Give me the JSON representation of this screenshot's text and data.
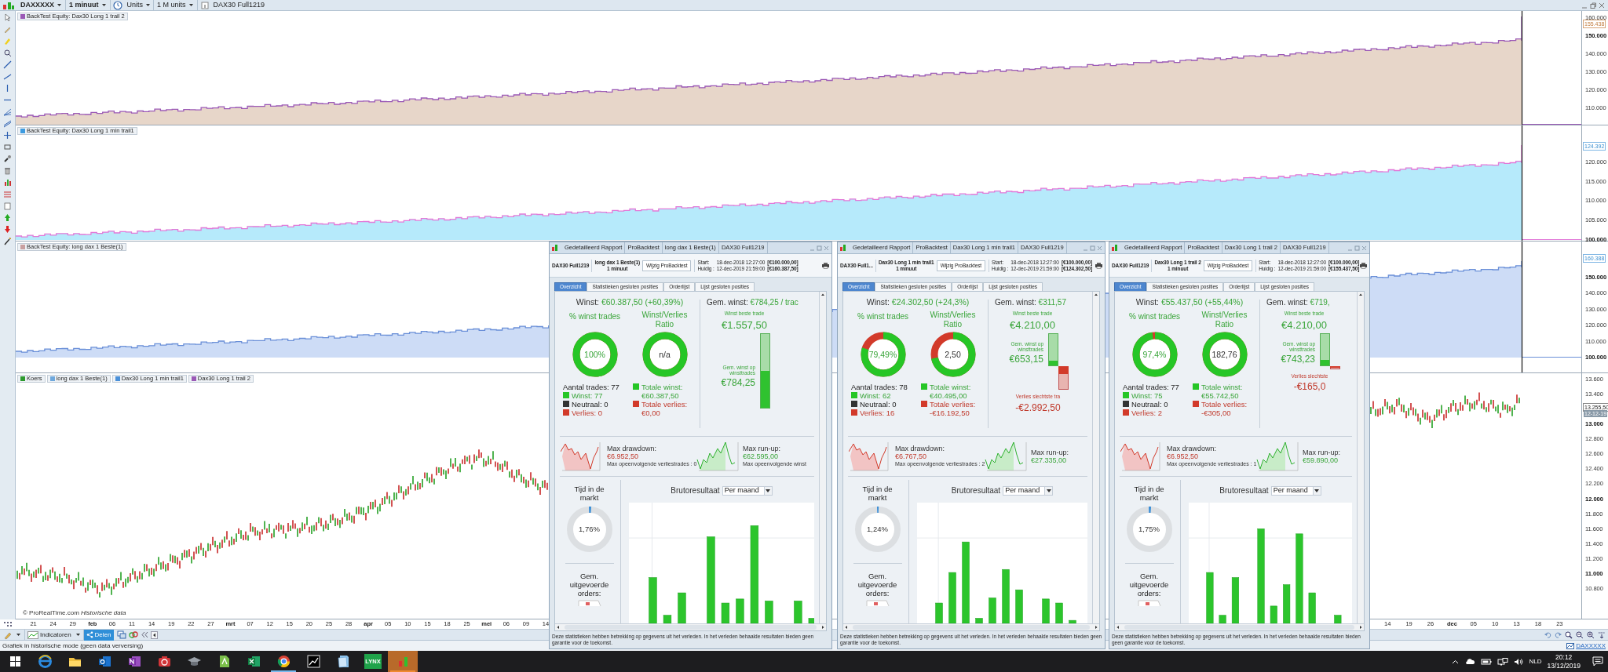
{
  "toolbar": {
    "items": [
      {
        "kind": "dropdown",
        "label": "DAXXXXX"
      },
      {
        "kind": "dropdown",
        "label": "1 minuut"
      },
      {
        "kind": "units",
        "label": "Units"
      },
      {
        "kind": "dropdown",
        "label": "1 M units"
      },
      {
        "kind": "info",
        "label": "DAX30 Full1219"
      }
    ]
  },
  "panes": [
    {
      "legend": [
        {
          "label": "BackTest Equity: Dax30 Long 1 trail 2",
          "color": "#9b59b6"
        }
      ],
      "last_value": "155.438",
      "ticks": [
        {
          "label": "160.000",
          "major": false
        },
        {
          "label": "150.000",
          "major": true
        },
        {
          "label": "140.000",
          "major": false
        },
        {
          "label": "130.000",
          "major": false
        },
        {
          "label": "120.000",
          "major": false
        },
        {
          "label": "110.000",
          "major": false
        }
      ]
    },
    {
      "legend": [
        {
          "label": "BackTest Equity: Dax30 Long 1 min trail1",
          "color": "#3d9be0"
        }
      ],
      "last_value": "124.392",
      "ticks": [
        {
          "label": "120.000",
          "major": false
        },
        {
          "label": "115.000",
          "major": false
        },
        {
          "label": "110.000",
          "major": false
        },
        {
          "label": "105.000",
          "major": false
        },
        {
          "label": "100.000",
          "major": true
        }
      ]
    },
    {
      "legend": [
        {
          "label": "BackTest Equity: long dax 1 Beste(1)",
          "color": "#c9a0a0"
        }
      ],
      "last_value": "160.388",
      "ticks": [
        {
          "label": "150.000",
          "major": true
        },
        {
          "label": "140.000",
          "major": false
        },
        {
          "label": "130.000",
          "major": false
        },
        {
          "label": "120.000",
          "major": false
        },
        {
          "label": "110.000",
          "major": false
        },
        {
          "label": "100.000",
          "major": true
        }
      ]
    },
    {
      "legend": [
        {
          "label": "Koers",
          "color": "#2e9a2e"
        },
        {
          "label": "long dax 1 Beste(1)",
          "color": "#6fa8dc"
        },
        {
          "label": "Dax30 Long 1 min trail1",
          "color": "#4a90d9"
        },
        {
          "label": "Dax30 Long 1 trail 2",
          "color": "#9b59b6"
        }
      ],
      "last_value": "13.255,50",
      "date_tag": "12-12-19",
      "ticks": [
        {
          "label": "13.600",
          "major": false
        },
        {
          "label": "13.400",
          "major": false
        },
        {
          "label": "13.000",
          "major": true
        },
        {
          "label": "12.800",
          "major": false
        },
        {
          "label": "12.600",
          "major": false
        },
        {
          "label": "12.400",
          "major": false
        },
        {
          "label": "12.200",
          "major": false
        },
        {
          "label": "12.000",
          "major": true
        },
        {
          "label": "11.800",
          "major": false
        },
        {
          "label": "11.600",
          "major": false
        },
        {
          "label": "11.400",
          "major": false
        },
        {
          "label": "11.200",
          "major": false
        },
        {
          "label": "11.000",
          "major": true
        },
        {
          "label": "10.800",
          "major": false
        }
      ]
    }
  ],
  "attribution": "© ProRealTime.com *Historische data*",
  "date_axis": {
    "left": [
      {
        "label": "21",
        "month": false
      },
      {
        "label": "24",
        "month": false
      },
      {
        "label": "29",
        "month": false
      },
      {
        "label": "feb",
        "month": true
      },
      {
        "label": "06",
        "month": false
      },
      {
        "label": "11",
        "month": false
      },
      {
        "label": "14",
        "month": false
      },
      {
        "label": "19",
        "month": false
      },
      {
        "label": "22",
        "month": false
      },
      {
        "label": "27",
        "month": false
      },
      {
        "label": "mrt",
        "month": true
      },
      {
        "label": "07",
        "month": false
      },
      {
        "label": "12",
        "month": false
      },
      {
        "label": "15",
        "month": false
      },
      {
        "label": "20",
        "month": false
      },
      {
        "label": "25",
        "month": false
      },
      {
        "label": "28",
        "month": false
      },
      {
        "label": "apr",
        "month": true
      },
      {
        "label": "05",
        "month": false
      },
      {
        "label": "10",
        "month": false
      },
      {
        "label": "15",
        "month": false
      },
      {
        "label": "18",
        "month": false
      },
      {
        "label": "25",
        "month": false
      },
      {
        "label": "mei",
        "month": true
      },
      {
        "label": "06",
        "month": false
      },
      {
        "label": "09",
        "month": false
      },
      {
        "label": "14",
        "month": false
      }
    ],
    "right": [
      {
        "label": "14",
        "month": false
      },
      {
        "label": "19",
        "month": false
      },
      {
        "label": "26",
        "month": false
      },
      {
        "label": "dec",
        "month": true
      },
      {
        "label": "05",
        "month": false
      },
      {
        "label": "10",
        "month": false
      },
      {
        "label": "13",
        "month": false
      },
      {
        "label": "18",
        "month": false
      },
      {
        "label": "23",
        "month": false
      }
    ]
  },
  "bottom_toolbar": {
    "indicators": "Indicatoren",
    "share": "Delen"
  },
  "status_bar": {
    "text": "Grafiek in historische mode (geen data verversing)",
    "symbol_link": "DAXXXXX"
  },
  "reports": [
    {
      "title_segments": [
        "Gedetailleerd Rapport",
        "ProBacktest",
        "long dax 1 Beste(1)",
        "DAX30 Full1219"
      ],
      "instrument": "DAX30 Full1219",
      "system": "long dax 1 Beste(1)",
      "timeframe": "1 minuut",
      "edit_button": "Wijzig ProBacktest",
      "start_label": "Start:",
      "start_date": "18-dec-2018 12:27:00",
      "start_capital": "[€100.000,00]",
      "current_label": "Huidig :",
      "current_date": "12-dec-2019 21:59:00",
      "current_capital": "[€160.387,50]",
      "tabs": [
        {
          "label": "Overzicht",
          "selected": true
        },
        {
          "label": "Statistieken gesloten posities",
          "selected": false
        },
        {
          "label": "Orderlijst",
          "selected": false
        },
        {
          "label": "Lijst gesloten posities",
          "selected": false
        }
      ],
      "profit_label": "Winst:",
      "profit": "€60.387,50 (+60,39%)",
      "win_trades": {
        "title": "% winst trades",
        "value": "100%",
        "level": 1
      },
      "ratio": {
        "title": "Winst/Verlies Ratio",
        "value": "n/a",
        "level": 1
      },
      "trade_count": "Aantal trades: 77",
      "wins": "Winst: 77",
      "neutral": "Neutraal: 0",
      "losses": "Verlies: 0",
      "total_win_label": "Totale winst:",
      "total_win": "€60.387,50",
      "total_loss_label": "Totale verlies:",
      "total_loss": "€0,00",
      "avg_label": "Gem. winst:",
      "avg": "€784,25 / trac",
      "best_label": "Winst beste trade",
      "best": "€1.557,50",
      "avg_win_label": "Gem. winst op winsttrades",
      "avg_win": "€784,25",
      "win_bar": {
        "level": 0.5
      },
      "drawdown_label": "Max drawdown:",
      "drawdown": "€6.952,50",
      "losing_streak": "Max opeenvolgende verliestrades : 0",
      "runup_label": "Max run-up:",
      "runup": "€62.595,00",
      "winning_streak": "Max opeenvolgende winst",
      "time_in_market": {
        "label": "Tijd in de markt",
        "value": "1,76%",
        "level": 0.0176
      },
      "gross_label": "Brutoresultaat",
      "period": "Per maand",
      "orders_label": "Gem. uitgevoerde orders:",
      "disclaimer": "Deze statistieken hebben betrekking op gegevens uit het verleden. In het verleden behaalde resultaten bieden geen garantie voor de toekomst."
    },
    {
      "title_segments": [
        "Gedetailleerd Rapport",
        "ProBacktest",
        "Dax30 Long 1 min trail1",
        "DAX30 Full1219"
      ],
      "instrument": "DAX30 Full1...",
      "system": "Dax30 Long 1 min trail1",
      "timeframe": "1 minuut",
      "edit_button": "Wijzig ProBacktest",
      "start_label": "Start:",
      "start_date": "18-dec-2018 12:27:00",
      "start_capital": "[€100.000,00]",
      "current_label": "Huidig :",
      "current_date": "12-dec-2019 21:59:00",
      "current_capital": "[€124.302,50]",
      "tabs": [
        {
          "label": "Overzicht",
          "selected": true
        },
        {
          "label": "Statistieken gesloten posities",
          "selected": false
        },
        {
          "label": "Orderlijst",
          "selected": false
        },
        {
          "label": "Lijst gesloten posities",
          "selected": false
        }
      ],
      "profit_label": "Winst:",
      "profit": "€24.302,50 (+24,3%)",
      "win_trades": {
        "title": "% winst trades",
        "value": "79,49%",
        "level": 0.7949
      },
      "ratio": {
        "title": "Winst/Verlies Ratio",
        "value": "2,50",
        "level": 0.714
      },
      "trade_count": "Aantal trades: 78",
      "wins": "Winst: 62",
      "neutral": "Neutraal: 0",
      "losses": "Verlies: 16",
      "total_win_label": "Totale winst:",
      "total_win": "€40.495,00",
      "total_loss_label": "Totale verlies:",
      "total_loss": "-€16.192,50",
      "avg_label": "Gem. winst:",
      "avg": "€311,57",
      "best_label": "Winst beste trade",
      "best": "€4.210,00",
      "avg_win_label": "Gem. winst op winsttrades",
      "avg_win": "€653,15",
      "win_bar": {
        "level": 0.155
      },
      "worst_label": "Verlies slechtste tra",
      "worst": "-€2.992,50",
      "drawdown_label": "Max drawdown:",
      "drawdown": "€6.767,50",
      "losing_streak": "Max opeenvolgende verliestrades : 2",
      "runup_label": "Max run-up:",
      "runup": "€27.335,00",
      "time_in_market": {
        "label": "Tijd in de markt",
        "value": "1,24%",
        "level": 0.0124
      },
      "gross_label": "Brutoresultaat",
      "period": "Per maand",
      "orders_label": "Gem. uitgevoerde orders:",
      "disclaimer": "Deze statistieken hebben betrekking op gegevens uit het verleden. In het verleden behaalde resultaten bieden geen garantie voor de toekomst."
    },
    {
      "title_segments": [
        "Gedetailleerd Rapport",
        "ProBacktest",
        "Dax30 Long 1 trail 2",
        "DAX30 Full1219"
      ],
      "instrument": "DAX30 Full1219",
      "system": "Dax30 Long 1 trail 2",
      "timeframe": "1 minuut",
      "edit_button": "Wijzig ProBacktest",
      "start_label": "Start:",
      "start_date": "18-dec-2018 12:27:00",
      "start_capital": "[€100.000,00]",
      "current_label": "Huidig :",
      "current_date": "12-dec-2019 21:59:00",
      "current_capital": "[€155.437,50]",
      "tabs": [
        {
          "label": "Overzicht",
          "selected": true
        },
        {
          "label": "Statistieken gesloten posities",
          "selected": false
        },
        {
          "label": "Orderlijst",
          "selected": false
        },
        {
          "label": "Lijst gesloten posities",
          "selected": false
        }
      ],
      "profit_label": "Winst:",
      "profit": "€55.437,50 (+55,44%)",
      "win_trades": {
        "title": "% winst trades",
        "value": "97,4%",
        "level": 0.974
      },
      "ratio": {
        "title": "Winst/Verlies Ratio",
        "value": "182,76",
        "level": 0.9946
      },
      "trade_count": "Aantal trades: 77",
      "wins": "Winst: 75",
      "neutral": "Neutraal: 0",
      "losses": "Verlies: 2",
      "total_win_label": "Totale winst:",
      "total_win": "€55.742,50",
      "total_loss_label": "Totale verlies:",
      "total_loss": "-€305,00",
      "avg_label": "Gem. winst:",
      "avg": "€719,",
      "best_label": "Winst beste trade",
      "best": "€4.210,00",
      "avg_win_label": "Gem. winst op winsttrades",
      "avg_win": "€743,23",
      "win_bar": {
        "level": 0.18
      },
      "worst_label": "Verlies slechtste",
      "worst": "-€165,0",
      "drawdown_label": "Max drawdown:",
      "drawdown": "€6.952,50",
      "losing_streak": "Max opeenvolgende verliestrades : 1",
      "runup_label": "Max run-up:",
      "runup": "€59.890,00",
      "time_in_market": {
        "label": "Tijd in de markt",
        "value": "1,75%",
        "level": 0.0175
      },
      "gross_label": "Brutoresultaat",
      "period": "Per maand",
      "orders_label": "Gem. uitgevoerde orders:",
      "disclaimer": "Deze statistieken hebben betrekking op gegevens uit het verleden. In het verleden behaalde resultaten bieden geen garantie voor de toekomst."
    }
  ],
  "taskbar": {
    "apps": [
      {
        "kind": "start",
        "running": false,
        "active": false
      },
      {
        "kind": "edge",
        "running": false,
        "active": false
      },
      {
        "kind": "folder",
        "running": false,
        "active": false
      },
      {
        "kind": "mail",
        "running": false,
        "active": false
      },
      {
        "kind": "notes",
        "running": false,
        "active": false
      },
      {
        "kind": "camera",
        "running": false,
        "active": false
      },
      {
        "kind": "cap",
        "running": false,
        "active": false
      },
      {
        "kind": "pdf",
        "running": false,
        "active": false
      },
      {
        "kind": "sheet",
        "running": false,
        "active": false
      },
      {
        "kind": "browser",
        "running": true,
        "active": false
      },
      {
        "kind": "stock",
        "running": false,
        "active": false
      },
      {
        "kind": "doc",
        "running": false,
        "active": false
      },
      {
        "kind": "label",
        "label": "LYNX",
        "running": false,
        "active": false
      },
      {
        "kind": "chart",
        "running": true,
        "active": true
      }
    ],
    "language": "NLD",
    "time": "20:12",
    "date": "13/12/2019"
  }
}
